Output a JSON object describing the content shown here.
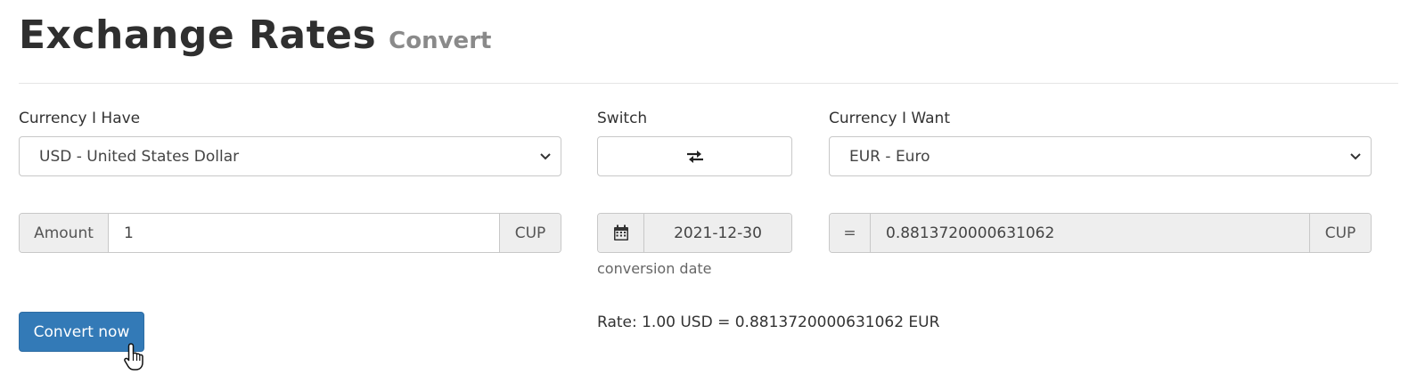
{
  "header": {
    "title": "Exchange Rates",
    "subtitle": "Convert"
  },
  "from": {
    "label": "Currency I Have",
    "selected": "USD - United States Dollar"
  },
  "switch": {
    "label": "Switch"
  },
  "to": {
    "label": "Currency I Want",
    "selected": "EUR - Euro"
  },
  "amount": {
    "prefix": "Amount",
    "value": "1",
    "suffix": "CUP"
  },
  "date": {
    "value": "2021-12-30",
    "helper": "conversion date"
  },
  "result": {
    "prefix": "=",
    "value": "0.8813720000631062",
    "suffix": "CUP"
  },
  "rate_text": "Rate: 1.00 USD = 0.8813720000631062 EUR",
  "convert_button": {
    "label": "Convert now"
  },
  "colors": {
    "primary": "#337ab7",
    "addon_bg": "#eeeeee",
    "border": "#c8c8c8"
  },
  "icons": {
    "switch": "swap-arrows-icon",
    "date": "calendar-icon",
    "dropdown": "chevron-down-icon"
  }
}
